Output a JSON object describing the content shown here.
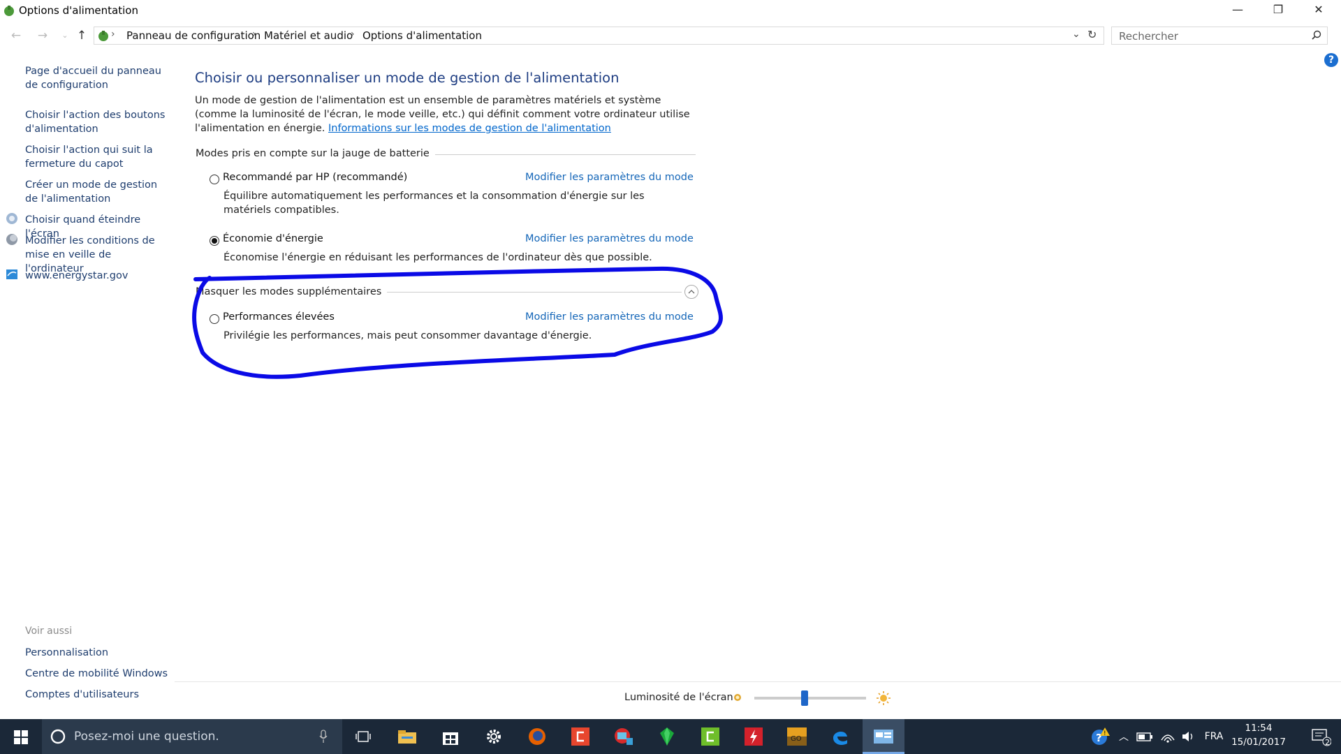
{
  "window": {
    "title": "Options d'alimentation",
    "minimize": "—",
    "maximize": "❐",
    "close": "✕"
  },
  "addressbar": {
    "crumbs": [
      "Panneau de configuration",
      "Matériel et audio",
      "Options d'alimentation"
    ],
    "search_placeholder": "Rechercher"
  },
  "sidebar": {
    "links": [
      "Page d'accueil du panneau de configuration",
      "Choisir l'action des boutons d'alimentation",
      "Choisir l'action qui suit la fermeture du capot",
      "Créer un mode de gestion de l'alimentation",
      "Choisir quand éteindre l'écran",
      "Modifier les conditions de mise en veille de l'ordinateur",
      "www.energystar.gov"
    ],
    "see_also_title": "Voir aussi",
    "see_also": [
      "Personnalisation",
      "Centre de mobilité Windows",
      "Comptes d'utilisateurs"
    ]
  },
  "main": {
    "title": "Choisir ou personnaliser un mode de gestion de l'alimentation",
    "description": "Un mode de gestion de l'alimentation est un ensemble de paramètres matériels et système (comme la luminosité de l'écran, le mode veille, etc.) qui définit comment votre ordinateur utilise l'alimentation en énergie. ",
    "info_link": "Informations sur les modes de gestion de l'alimentation",
    "section_battery": "Modes pris en compte sur la jauge de batterie",
    "section_extra": "Masquer les modes supplémentaires",
    "plans": [
      {
        "name": "Recommandé par HP (recommandé)",
        "desc": "Équilibre automatiquement les performances et la consommation d'énergie sur les matériels compatibles.",
        "link": "Modifier les paramètres du mode",
        "selected": false
      },
      {
        "name": "Économie d'énergie",
        "desc": "Économise l'énergie en réduisant les performances de l'ordinateur dès que possible.",
        "link": "Modifier les paramètres du mode",
        "selected": true
      },
      {
        "name": "Performances élevées",
        "desc": "Privilégie les performances, mais peut consommer davantage d'énergie.",
        "link": "Modifier les paramètres du mode",
        "selected": false
      }
    ]
  },
  "brightness": {
    "label": "Luminosité de l'écran :",
    "level_percent": 45
  },
  "taskbar": {
    "cortana_placeholder": "Posez-moi une question.",
    "language": "FRA",
    "time": "11:54",
    "date": "15/01/2017",
    "notification_count": "2",
    "icons": [
      "task-view-icon",
      "file-explorer-icon",
      "store-icon",
      "settings-icon",
      "firefox-icon",
      "app-red-icon",
      "camera-app-icon",
      "gem-app-icon",
      "camtasia-icon",
      "flash-icon",
      "csgo-icon",
      "edge-icon",
      "control-panel-icon"
    ]
  },
  "colors": {
    "link": "#1466b8",
    "title": "#1e3d82",
    "annotation": "#0000e0",
    "taskbar": "#1b2838"
  }
}
